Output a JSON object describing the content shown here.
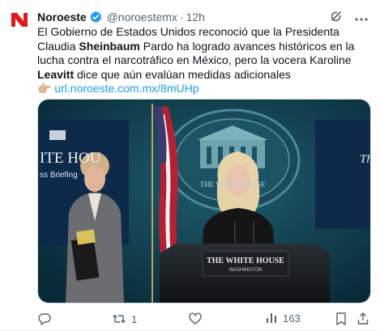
{
  "author": {
    "name": "Noroeste",
    "handle": "@noroestemx",
    "separator": "·",
    "time": "12h",
    "logo_letter": "N"
  },
  "tweet": {
    "part1": "El Gobierno de Estados Unidos reconoció que la Presidenta Claudia ",
    "bold1": "Sheinbaum",
    "part2": " Pardo ha logrado avances históricos en la lucha contra el narcotráfico en México, pero la vocera Karoline ",
    "bold2": "Leavitt",
    "part3": " dice que aún evalúan medidas adicionales",
    "pointer_emoji": "👉🏼",
    "link": "url.noroeste.com.mx/8mUHp"
  },
  "media": {
    "backdrop_left": "ITE HOU",
    "backdrop_left2": "ss Briefing",
    "backdrop_right": "Th",
    "seal_text": "THE WHITE HOUSE",
    "podium_title": "THE WHITE HOUSE",
    "podium_subtitle": "WASHINGTON"
  },
  "actions": {
    "reply_count": "",
    "retweet_count": "1",
    "like_count": "",
    "views_count": "163"
  },
  "colors": {
    "accent": "#1d9bf0",
    "muted": "#536471",
    "logo_red": "#e0191a"
  }
}
